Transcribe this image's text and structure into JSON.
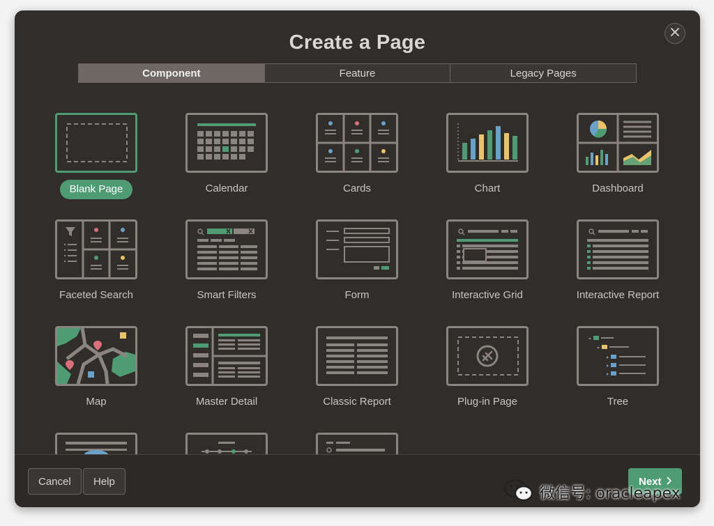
{
  "dialog": {
    "title": "Create a Page",
    "close_icon": "close-icon"
  },
  "tabs": [
    {
      "label": "Component",
      "active": true
    },
    {
      "label": "Feature",
      "active": false
    },
    {
      "label": "Legacy Pages",
      "active": false
    }
  ],
  "tiles": [
    {
      "label": "Blank Page",
      "icon": "blank-page-icon",
      "selected": true
    },
    {
      "label": "Calendar",
      "icon": "calendar-icon"
    },
    {
      "label": "Cards",
      "icon": "cards-icon"
    },
    {
      "label": "Chart",
      "icon": "chart-icon"
    },
    {
      "label": "Dashboard",
      "icon": "dashboard-icon"
    },
    {
      "label": "Faceted Search",
      "icon": "faceted-search-icon"
    },
    {
      "label": "Smart Filters",
      "icon": "smart-filters-icon"
    },
    {
      "label": "Form",
      "icon": "form-icon"
    },
    {
      "label": "Interactive Grid",
      "icon": "interactive-grid-icon"
    },
    {
      "label": "Interactive Report",
      "icon": "interactive-report-icon"
    },
    {
      "label": "Map",
      "icon": "map-icon"
    },
    {
      "label": "Master Detail",
      "icon": "master-detail-icon"
    },
    {
      "label": "Classic Report",
      "icon": "classic-report-icon"
    },
    {
      "label": "Plug-in Page",
      "icon": "plugin-page-icon"
    },
    {
      "label": "Tree",
      "icon": "tree-icon"
    }
  ],
  "footer": {
    "cancel_label": "Cancel",
    "help_label": "Help",
    "next_label": "Next"
  },
  "watermark": {
    "text": "微信号: oracleapex"
  },
  "colors": {
    "background": "#312d2a",
    "accent": "#4f9c74",
    "outline": "#8b8580"
  }
}
